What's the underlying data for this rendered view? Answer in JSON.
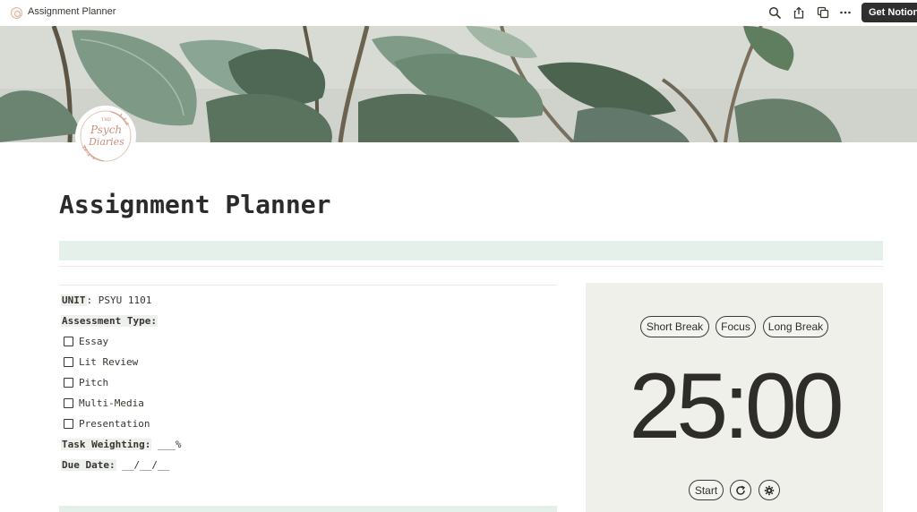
{
  "topbar": {
    "page_title": "Assignment Planner",
    "icons": [
      "search-icon",
      "share-icon",
      "duplicate-icon",
      "more-icon"
    ],
    "get_notion_label": "Get Notion"
  },
  "cover": {
    "description_icon": "plant-leaves-cover"
  },
  "logo": {
    "line1": "THE",
    "line2": "Psych",
    "line3": "Diaries"
  },
  "page": {
    "title": "Assignment Planner"
  },
  "form": {
    "unit_label": "UNIT",
    "unit_value": ": PSYU 1101",
    "assessment_type_label": "Assessment Type:",
    "assessment_types": [
      {
        "label": "Essay",
        "checked": false
      },
      {
        "label": "Lit Review",
        "checked": false
      },
      {
        "label": "Pitch",
        "checked": false
      },
      {
        "label": "Multi-Media",
        "checked": false
      },
      {
        "label": "Presentation",
        "checked": false
      }
    ],
    "task_weighting_label": "Task Weighting:",
    "task_weighting_value": " ___%",
    "due_date_label": "Due Date:",
    "due_date_value": " __/__/__"
  },
  "timer": {
    "modes": [
      "Short Break",
      "Focus",
      "Long Break"
    ],
    "time": "25:00",
    "start_label": "Start",
    "colors": {
      "background": "#f0f0eb",
      "text": "#2f2d2a"
    }
  },
  "colors": {
    "accent_green": "#e6f0ea",
    "logo_pink": "#d9a592"
  }
}
